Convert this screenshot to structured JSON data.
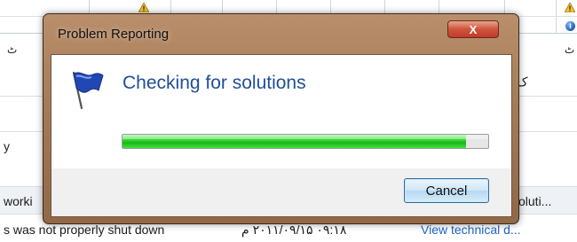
{
  "background": {
    "row1_left_text": "worki",
    "row1_right_text": "oluti...",
    "row2_left_text": "s was not properly shut down",
    "row2_date_text": "‏۰۹:۱۸ ۲۰۱۱/۰۹/۱۵ م",
    "row2_link_text": "View  technical d...",
    "mark_left_top": "ٹ",
    "mark_right_top": "ٹ",
    "mark_left_mid": "y",
    "mark_right_mid": "ک"
  },
  "dialog": {
    "title": "Problem Reporting",
    "heading": "Checking for solutions",
    "progress_fraction": 0.94,
    "cancel_label": "Cancel",
    "close_glyph": "X"
  },
  "colors": {
    "heading": "#1f4e99",
    "progress_green": "#1cb51b",
    "close_red": "#c0392b",
    "frame_brown": "#a47a57"
  },
  "icons": [
    "flag-icon",
    "warning-icon",
    "info-icon",
    "close-icon"
  ]
}
